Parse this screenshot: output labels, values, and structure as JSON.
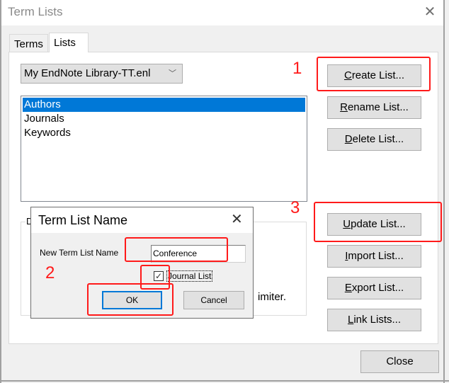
{
  "window": {
    "title": "Term Lists",
    "close_glyph": "✕"
  },
  "tabs": [
    {
      "label": "Terms",
      "active": false
    },
    {
      "label": "Lists",
      "active": true
    }
  ],
  "library_select": {
    "value": "My EndNote Library-TT.enl",
    "chevron": "﹀"
  },
  "term_lists": {
    "items": [
      "Authors",
      "Journals",
      "Keywords"
    ],
    "selected": "Authors"
  },
  "group": {
    "label_fragment": "D",
    "text_fragment": "imiter."
  },
  "buttons": {
    "create": {
      "accel": "C",
      "rest": "reate List..."
    },
    "rename": {
      "accel": "R",
      "rest": "ename List..."
    },
    "delete": {
      "accel": "D",
      "rest": "elete List..."
    },
    "update": {
      "accel": "U",
      "rest": "pdate List..."
    },
    "import": {
      "accel": "I",
      "rest": "mport List..."
    },
    "export": {
      "accel": "E",
      "rest": "xport List..."
    },
    "link": {
      "accel": "L",
      "rest": "ink Lists..."
    },
    "close": "Close"
  },
  "dialog": {
    "title": "Term List Name",
    "close_glyph": "✕",
    "field_label": "New Term List Name",
    "field_value": "Conference",
    "checkbox_label": "Journal List",
    "checkbox_checked": true,
    "check_glyph": "✓",
    "ok_label": "OK",
    "cancel_label": "Cancel"
  },
  "annotations": {
    "step1": "1",
    "step2": "2",
    "step3": "3",
    "color": "#ff1a1a"
  },
  "colors": {
    "selection": "#0078d7",
    "button_face": "#e1e1e1"
  }
}
